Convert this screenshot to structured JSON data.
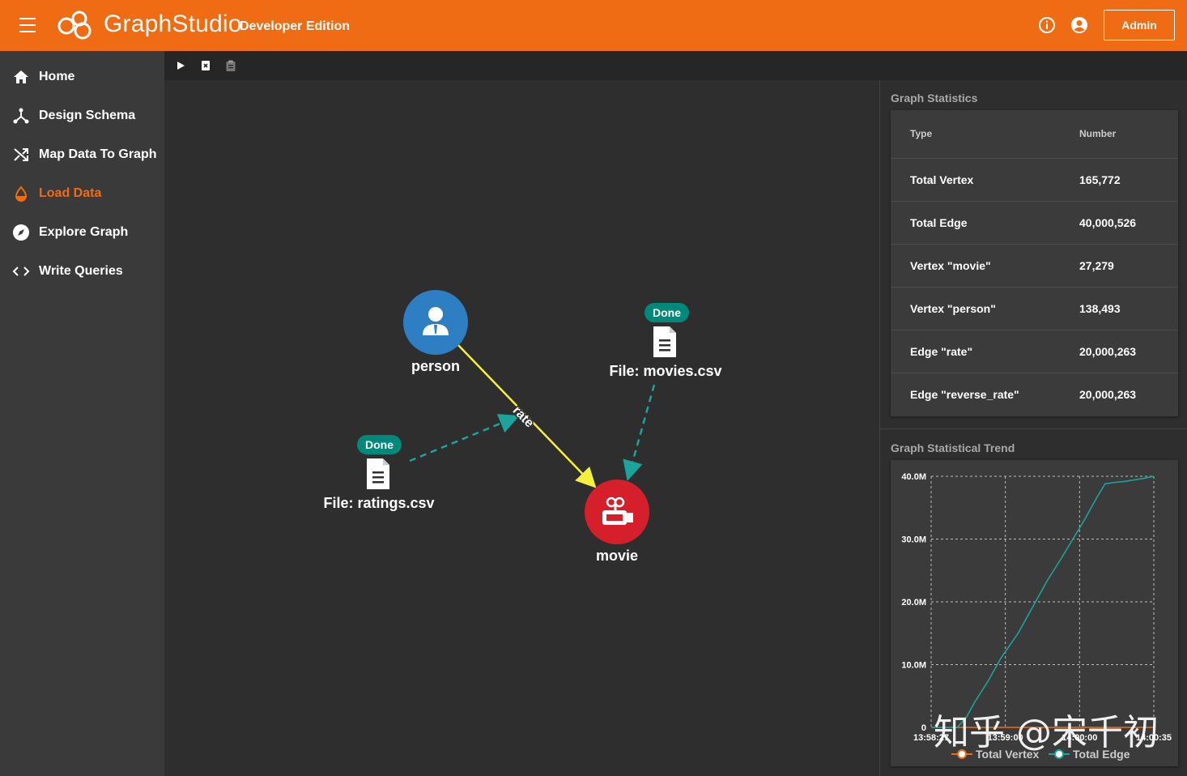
{
  "header": {
    "brand_bold": "Graph",
    "brand_light": "Studio",
    "edition": "Developer Edition",
    "admin_label": "Admin",
    "accent": "#ef6c15",
    "icons": [
      "menu-icon",
      "info-icon",
      "account-circle-icon"
    ]
  },
  "sidebar": {
    "items": [
      {
        "label": "Home",
        "icon": "home-icon",
        "active": false
      },
      {
        "label": "Design Schema",
        "icon": "schema-icon",
        "active": false
      },
      {
        "label": "Map Data To Graph",
        "icon": "shuffle-icon",
        "active": false
      },
      {
        "label": "Load Data",
        "icon": "drop-icon",
        "active": true
      },
      {
        "label": "Explore Graph",
        "icon": "compass-icon",
        "active": false
      },
      {
        "label": "Write Queries",
        "icon": "code-icon",
        "active": false
      }
    ]
  },
  "toolbar": {
    "icons": [
      "play-icon",
      "delete-file-icon",
      "clipboard-icon"
    ]
  },
  "graph": {
    "vertices": [
      {
        "label": "person",
        "color": "#2d7ec2",
        "icon": "user-icon"
      },
      {
        "label": "movie",
        "color": "#d51f2a",
        "icon": "movie-icon"
      }
    ],
    "edge_label": "rate",
    "files": [
      {
        "label": "File: movies.csv",
        "status": "Done"
      },
      {
        "label": "File: ratings.csv",
        "status": "Done"
      }
    ],
    "edge_color": "#f5f03b",
    "mapping_color": "#1ba39c"
  },
  "stats": {
    "title": "Graph Statistics",
    "columns": [
      "Type",
      "Number"
    ],
    "rows": [
      {
        "type": "Total Vertex",
        "number": "165,772"
      },
      {
        "type": "Total Edge",
        "number": "40,000,526"
      },
      {
        "type": "Vertex \"movie\"",
        "number": "27,279"
      },
      {
        "type": "Vertex \"person\"",
        "number": "138,493"
      },
      {
        "type": "Edge \"rate\"",
        "number": "20,000,263"
      },
      {
        "type": "Edge \"reverse_rate\"",
        "number": "20,000,263"
      }
    ]
  },
  "trend": {
    "title": "Graph Statistical Trend"
  },
  "chart_data": {
    "type": "line",
    "title": "",
    "xlabel": "",
    "ylabel": "",
    "ylim": [
      0,
      40000000
    ],
    "y_ticks": [
      "0",
      "10.0M",
      "20.0M",
      "30.0M",
      "40.0M"
    ],
    "x_ticks": [
      "13:58:27",
      "13:59:00",
      "14:00:00",
      "14:00:35"
    ],
    "x": [
      0,
      10,
      15,
      20,
      25,
      33,
      40,
      50,
      55,
      60,
      65,
      67,
      75,
      88,
      93,
      95,
      100,
      105,
      112,
      116,
      123,
      128
    ],
    "series": [
      {
        "name": "Total Vertex",
        "color": "#ef6c15",
        "values": [
          0,
          0,
          0,
          0,
          0,
          0,
          0,
          0,
          0,
          0,
          0,
          0,
          0,
          0,
          0,
          0,
          0,
          0,
          0,
          0,
          0,
          0
        ]
      },
      {
        "name": "Total Edge",
        "color": "#1ba39c",
        "values": [
          0,
          0,
          0,
          1500000,
          4000000,
          7500000,
          11000000,
          15000000,
          17500000,
          20000000,
          22500000,
          23500000,
          27000000,
          33000000,
          35500000,
          36500000,
          38800000,
          39000000,
          39200000,
          39400000,
          39700000,
          40000526
        ]
      }
    ],
    "grid": true,
    "legend": "bottom"
  },
  "watermark": "知乎 @宋千初"
}
